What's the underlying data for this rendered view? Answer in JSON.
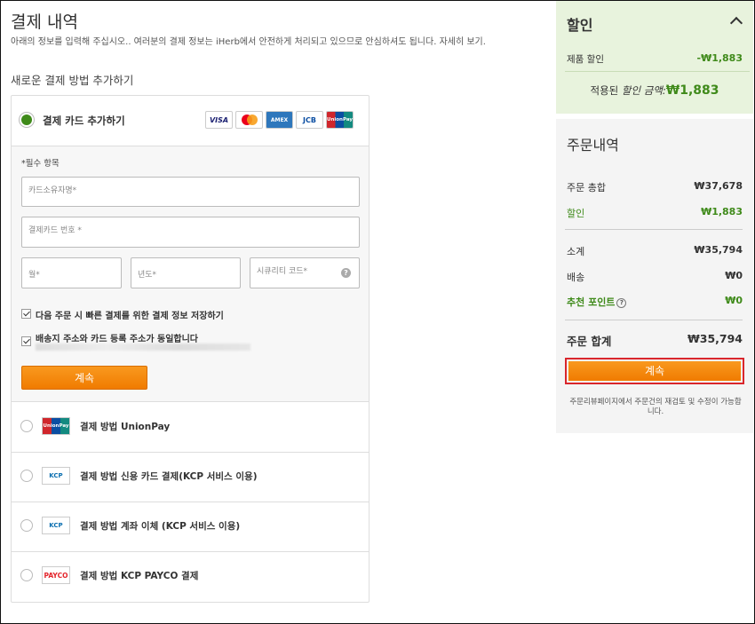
{
  "page": {
    "title": "결제 내역",
    "description": "아래의 정보를 입력해 주십시오.. 여러분의 결제 정보는 iHerb에서 안전하게 처리되고 있으므로 안심하셔도 됩니다. 자세히 보기.",
    "subtitle": "새로운 결제 방법 추가하기"
  },
  "card": {
    "label": "결제 카드 추가하기",
    "logos": [
      "VISA",
      "MC",
      "AMEX",
      "JCB",
      "UnionPay"
    ],
    "required_note": "*필수 항목",
    "fields": {
      "holder": "카드소유자명*",
      "number": "결제카드 번호 *",
      "month": "월*",
      "year": "년도*",
      "cvc": "시큐리티 코드*"
    },
    "save_label": "다음 주문 시 빠른 결제를 위한 결제 정보 저장하기",
    "same_address_label": "배송지 주소와 카드 등록 주소가 동일합니다",
    "continue_label": "계속"
  },
  "methods": [
    {
      "logo": "UnionPay",
      "label": "결제 방법 UnionPay"
    },
    {
      "logo": "KCP",
      "label": "결제 방법 신용 카드 결제(KCP 서비스 이용)"
    },
    {
      "logo": "KCP",
      "label": "결제 방법 계좌 이체 (KCP 서비스 이용)"
    },
    {
      "logo": "PAYCO",
      "label": "결제 방법 KCP PAYCO 결제"
    }
  ],
  "discount": {
    "title": "할인",
    "product_label": "제품 할인",
    "product_value": "-₩1,883",
    "applied_prefix": "적용된",
    "applied_label": "할인 금액:",
    "applied_value": "₩1,883"
  },
  "order": {
    "title": "주문내역",
    "subtotal_label": "주문 총합",
    "subtotal_value": "₩37,678",
    "discount_label": "할인",
    "discount_value": "₩1,883",
    "sum_label": "소계",
    "sum_value": "₩35,794",
    "shipping_label": "배송",
    "shipping_value": "₩0",
    "points_label": "추천 포인트",
    "points_value": "₩0",
    "total_label": "주문 합계",
    "total_value": "₩35,794",
    "button_label": "계속",
    "note": "주문리뷰페이지에서 주문건의 재검토 및 수정이 가능합니다."
  },
  "colors": {
    "accent": "#f07b00",
    "green": "#3f8a1a",
    "highlight": "#d9262c"
  }
}
